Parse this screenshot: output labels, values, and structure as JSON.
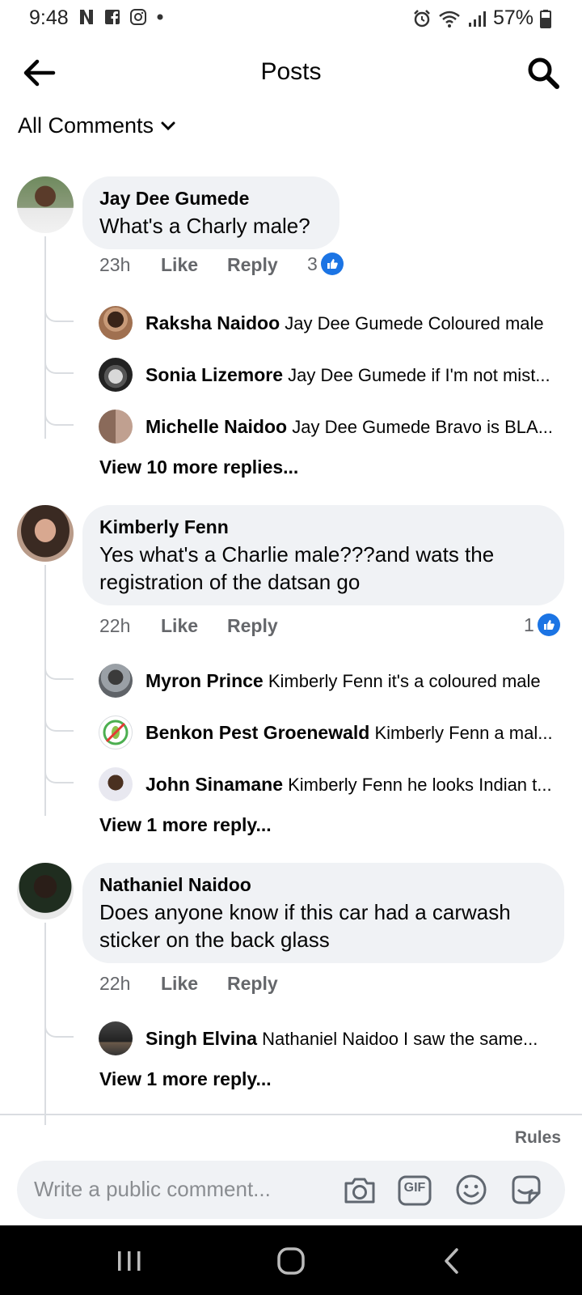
{
  "status_bar": {
    "time": "9:48",
    "battery": "57%"
  },
  "header": {
    "title": "Posts"
  },
  "filter": {
    "label": "All Comments"
  },
  "comments": [
    {
      "author": "Jay Dee Gumede",
      "text": "What's a Charly male?",
      "time": "23h",
      "like_label": "Like",
      "reply_label": "Reply",
      "reaction_count": "3",
      "replies": [
        {
          "author": "Raksha Naidoo",
          "text": "Jay Dee Gumede Coloured male"
        },
        {
          "author": "Sonia Lizemore",
          "text": "Jay Dee Gumede if I'm not mist..."
        },
        {
          "author": "Michelle Naidoo",
          "text": "Jay Dee Gumede Bravo is BLA..."
        }
      ],
      "view_more": "View 10 more replies..."
    },
    {
      "author": "Kimberly Fenn",
      "text": "Yes what's a Charlie male???and wats the registration of the datsan go",
      "time": "22h",
      "like_label": "Like",
      "reply_label": "Reply",
      "reaction_count": "1",
      "replies": [
        {
          "author": "Myron Prince",
          "text": "Kimberly Fenn it's a coloured male"
        },
        {
          "author": "Benkon Pest Groenewald",
          "text": "Kimberly Fenn a mal..."
        },
        {
          "author": "John Sinamane",
          "text": "Kimberly Fenn he looks Indian t..."
        }
      ],
      "view_more": "View 1 more reply..."
    },
    {
      "author": "Nathaniel Naidoo",
      "text": "Does anyone know if this car had a carwash sticker on the back glass",
      "time": "22h",
      "like_label": "Like",
      "reply_label": "Reply",
      "replies": [
        {
          "author": "Singh Elvina",
          "text": "Nathaniel Naidoo I saw the same..."
        }
      ],
      "view_more": "View 1 more reply..."
    }
  ],
  "rules_label": "Rules",
  "composer": {
    "placeholder": "Write a public comment...",
    "gif_label": "GIF"
  },
  "colors": {
    "accent": "#1b74e4",
    "bubble": "#f0f2f5",
    "secondary_text": "#65676b"
  }
}
